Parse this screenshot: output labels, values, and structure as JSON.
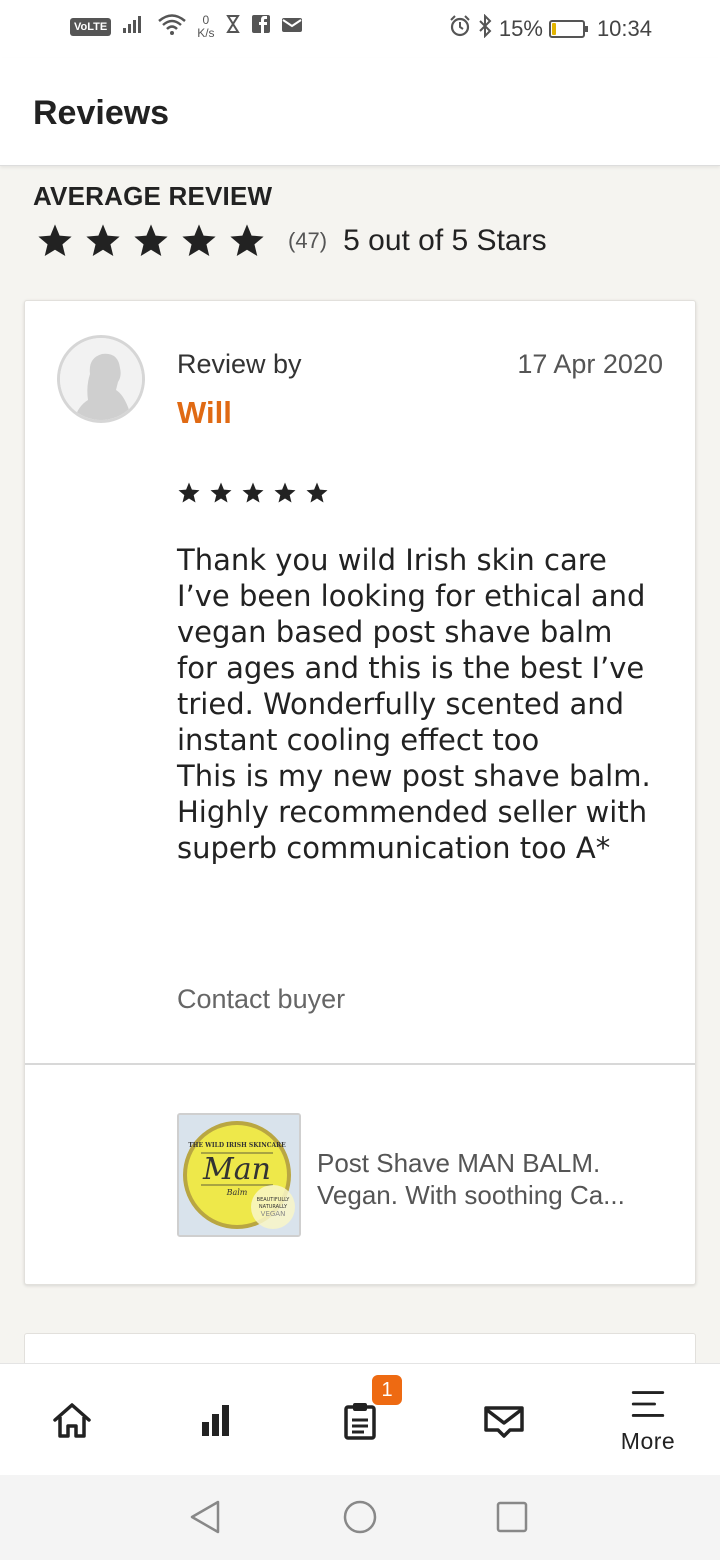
{
  "status_bar": {
    "volte": "VoLTE",
    "speed_value": "0",
    "speed_unit": "K/s",
    "battery_percent": "15%",
    "battery_level": 0.15,
    "time": "10:34"
  },
  "header": {
    "title": "Reviews"
  },
  "average": {
    "label": "AVERAGE REVIEW",
    "stars": 5,
    "count": "(47)",
    "text": "5 out of 5 Stars"
  },
  "review": {
    "by_label": "Review by",
    "reviewer": "Will",
    "date": "17 Apr 2020",
    "stars": 5,
    "body": "Thank you wild Irish skin care I’ve been looking for ethical and vegan based post shave balm for ages and this is the best I’ve tried. Wonderfully scented and instant cooling effect too\nThis is my new post shave balm. Highly recommended seller with superb communication too A*",
    "contact_label": "Contact buyer",
    "product": {
      "title_line1": "Post Shave MAN BALM.",
      "title_line2": "Vegan. With soothing Ca...",
      "image_brand": "THE WILD IRISH SKINCARE",
      "image_name": "Man",
      "image_sub": "Balm",
      "image_tag1": "BEAUTIFULLY",
      "image_tag2": "NATURALLY",
      "image_tag3": "VEGAN"
    }
  },
  "bottom_nav": {
    "badge_count": "1",
    "more_label": "More"
  },
  "colors": {
    "accent": "#e06a14",
    "badge": "#ee6a12",
    "background": "#f5f4f0"
  }
}
